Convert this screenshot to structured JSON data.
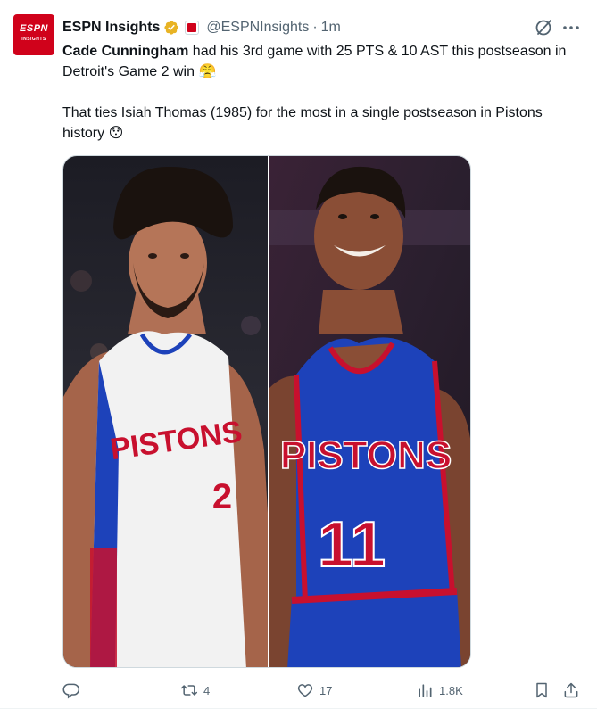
{
  "author": {
    "avatar_text": "ESPN",
    "avatar_subtext": "INSIGHTS",
    "display_name": "ESPN Insights",
    "handle": "@ESPNInsights",
    "separator": "·",
    "time": "1m",
    "verified_icon": "gold-verified-check",
    "affiliate_icon": "espn-affiliate-badge"
  },
  "tweet": {
    "mention": "Cade Cunningham",
    "line1_rest": " had his 3rd game with 25 PTS & 10 AST this postseason in Detroit's Game 2 win 😤",
    "line2": "That ties Isiah Thomas (1985) for the most in a single postseason in Pistons history 😯"
  },
  "media": {
    "left_jersey_team": "PISTONS",
    "left_jersey_number": "2",
    "right_jersey_team": "PISTONS",
    "right_jersey_number": "11"
  },
  "actions": {
    "reply_count": "",
    "retweet_count": "4",
    "like_count": "17",
    "views_count": "1.8K"
  },
  "colors": {
    "espn_red": "#d0021b",
    "pistons_blue": "#1d42ba",
    "pistons_red": "#c8102e",
    "muted_text": "#536471"
  }
}
